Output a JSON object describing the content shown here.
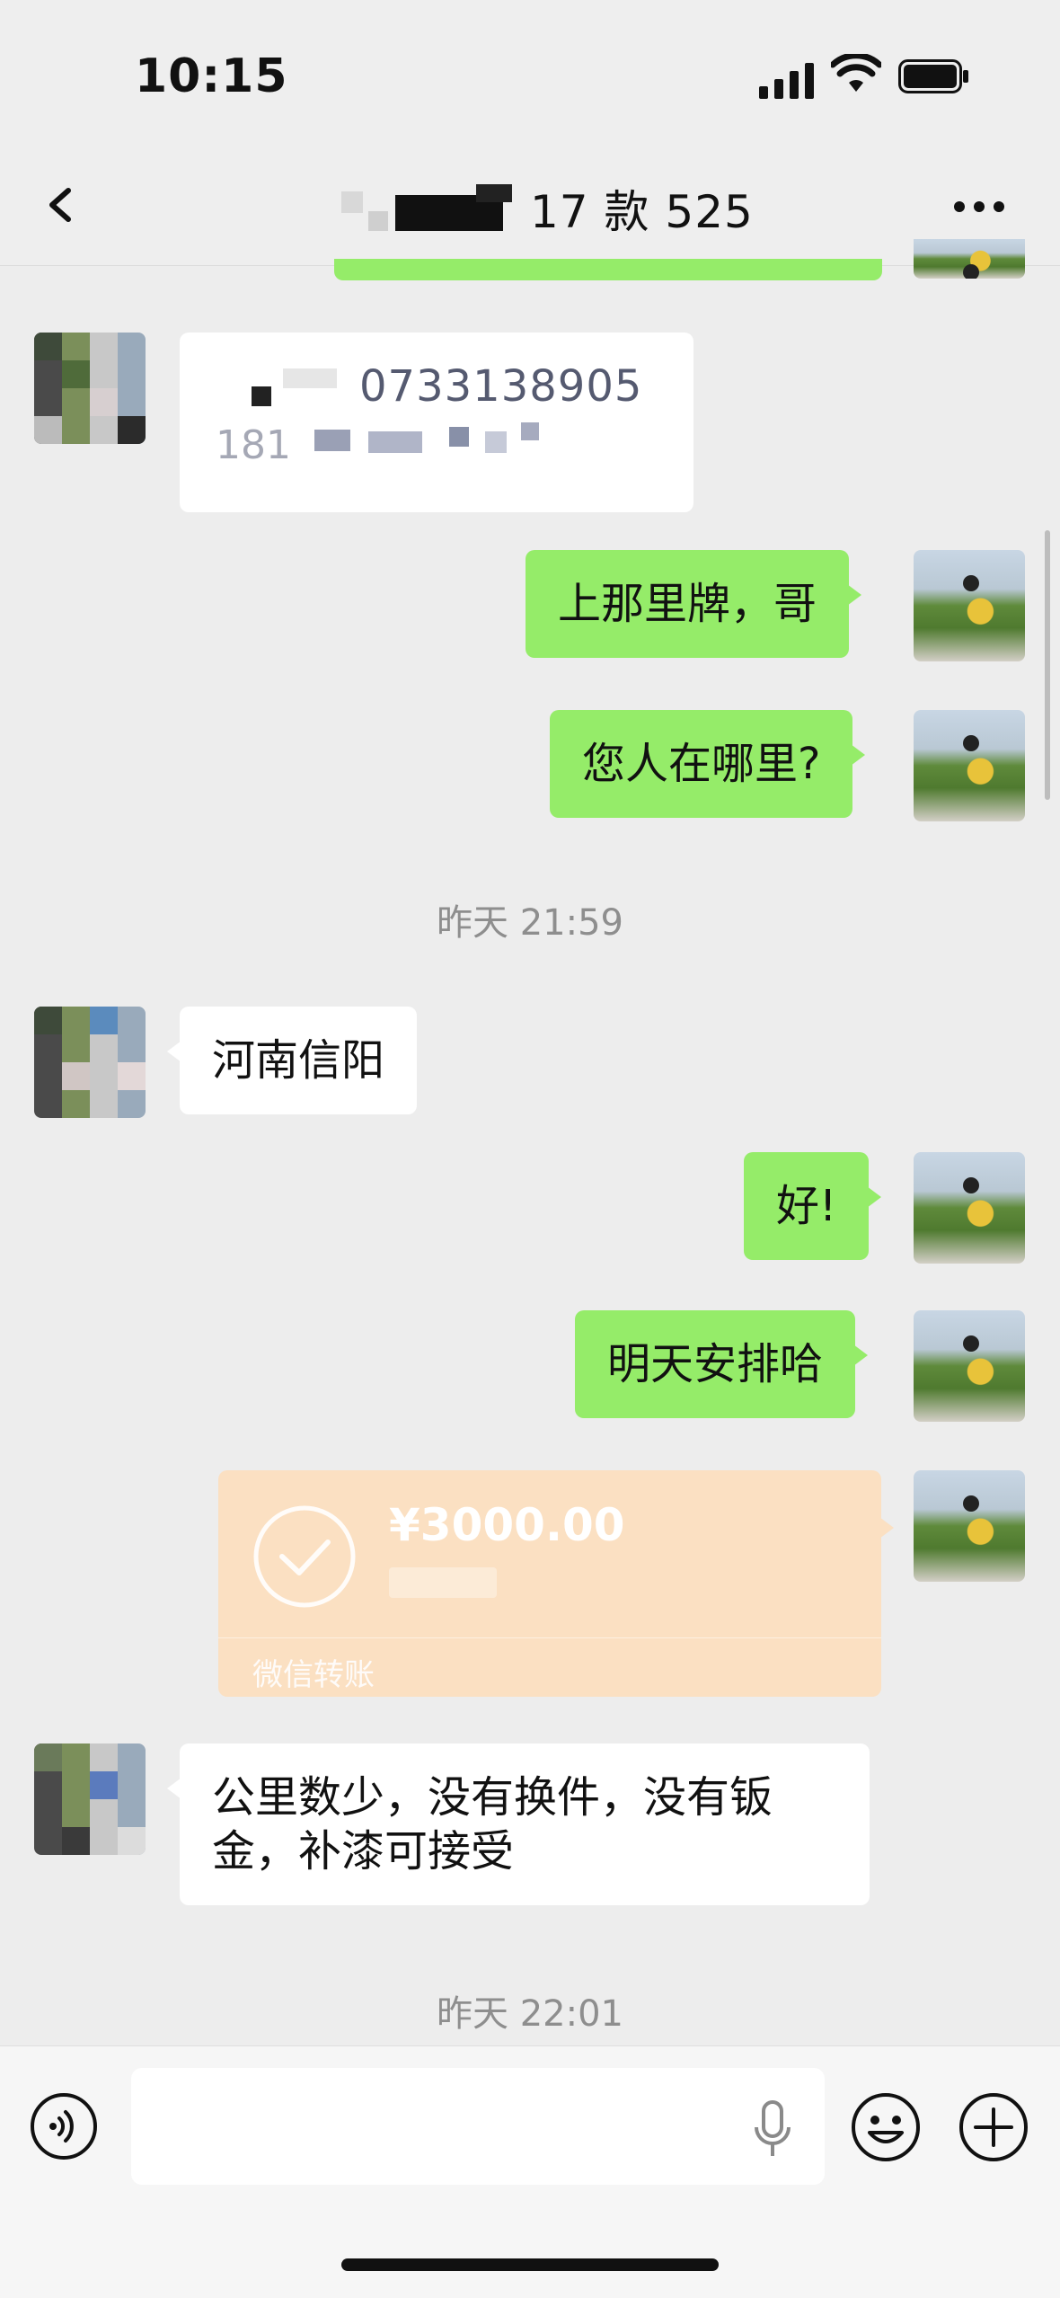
{
  "status": {
    "time": "10:15",
    "signal_icon": "cellular-signal-icon",
    "wifi_icon": "wifi-icon",
    "battery_icon": "battery-icon"
  },
  "nav": {
    "title": "17 款 525",
    "back_icon": "back-chevron-icon",
    "more_icon": "more-dots-icon"
  },
  "messages": {
    "top_partial": "",
    "contact_number": "0733138905",
    "contact_number_line2": "181",
    "m1": "上那里牌，哥",
    "m2": "您人在哪里?",
    "ts1": "昨天 21:59",
    "m3": "河南信阳",
    "m4": "好!",
    "m5": "明天安排哈",
    "m6": "公里数少，没有换件，没有钣金，补漆可接受",
    "ts2": "昨天 22:01"
  },
  "transfer": {
    "amount": "¥3000.00",
    "label": "微信转账"
  },
  "input_bar": {
    "placeholder": ""
  },
  "colors": {
    "my_bubble": "#95ec69",
    "their_bubble": "#ffffff",
    "transfer_bg": "#fbe0c2",
    "chat_bg": "#ededed"
  }
}
